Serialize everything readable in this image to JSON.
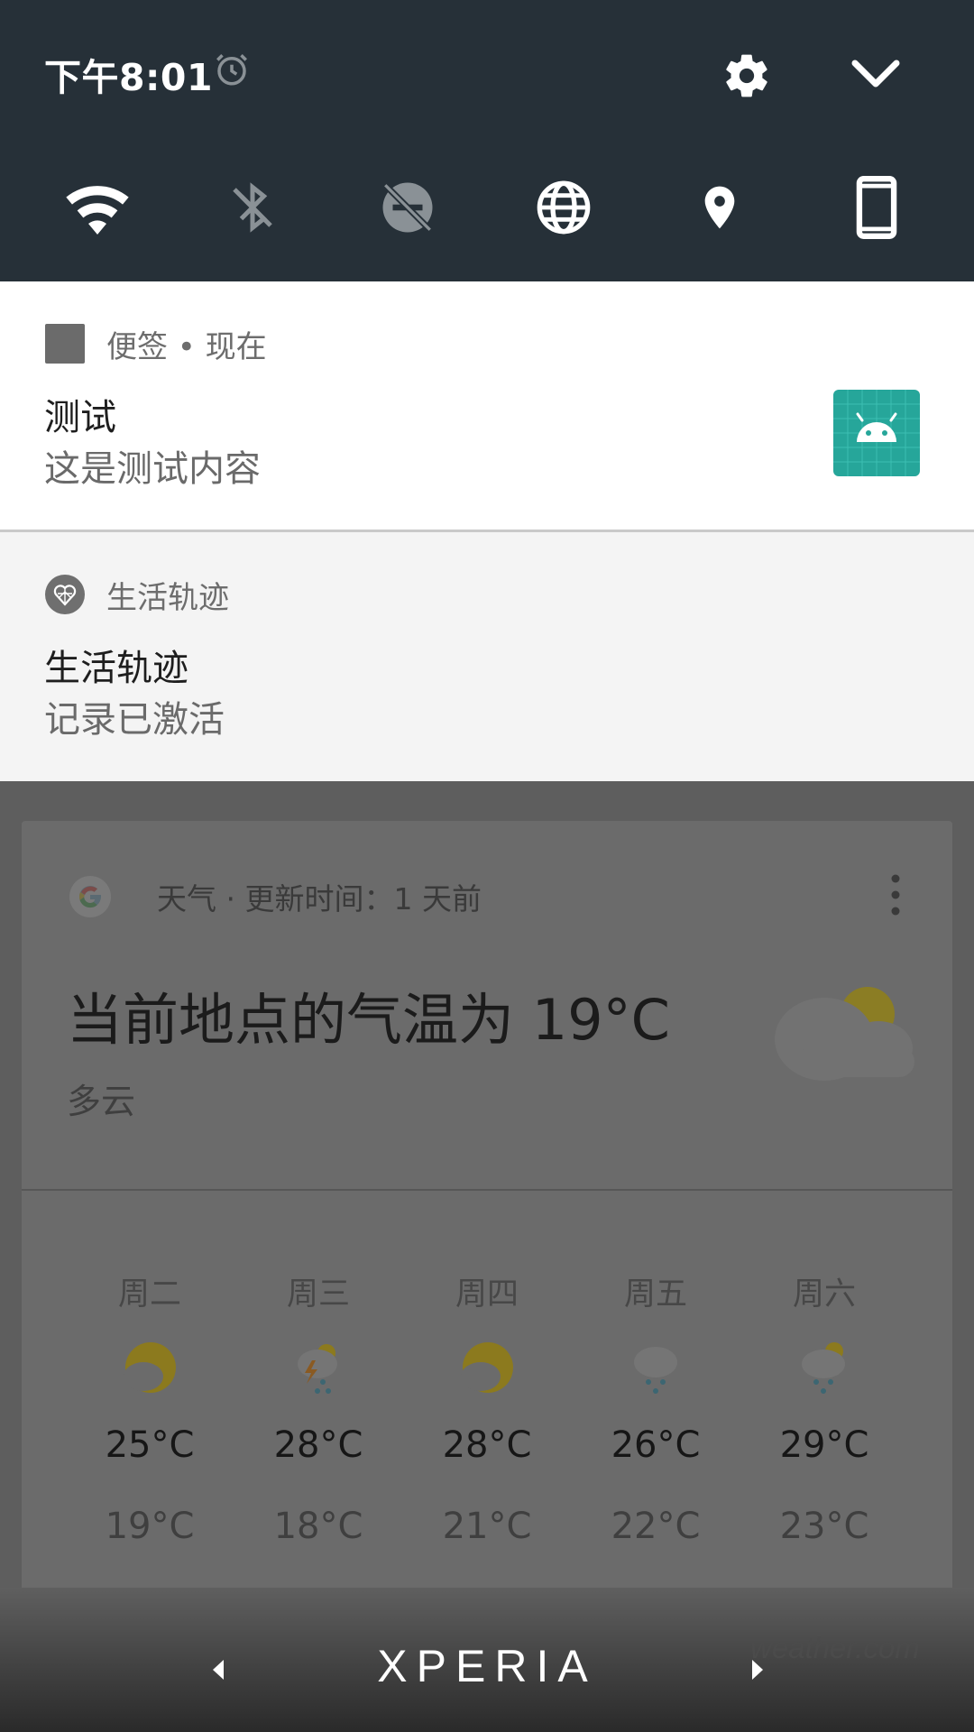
{
  "status": {
    "time": "下午8:01"
  },
  "quick_settings": {
    "tiles": [
      "wifi-icon",
      "bluetooth-off-icon",
      "do-not-disturb-off-icon",
      "globe-icon",
      "location-icon",
      "rotation-portrait-icon"
    ]
  },
  "notifications": [
    {
      "app": "便签 • 现在",
      "title": "测试",
      "text": "这是测试内容",
      "thumb_color": "#26a69a"
    },
    {
      "app": "生活轨迹",
      "title": "生活轨迹",
      "text": "记录已激活"
    }
  ],
  "weather_card": {
    "source": "天气 · 更新时间：1 天前",
    "current_temp": "当前地点的气温为 19°C",
    "condition": "多云",
    "forecast": [
      {
        "day": "周二",
        "icon": "partly-cloudy-icon",
        "high": "25°C",
        "low": "19°C"
      },
      {
        "day": "周三",
        "icon": "thunder-rain-icon",
        "high": "28°C",
        "low": "18°C"
      },
      {
        "day": "周四",
        "icon": "partly-cloudy-icon",
        "high": "28°C",
        "low": "21°C"
      },
      {
        "day": "周五",
        "icon": "rain-icon",
        "high": "26°C",
        "low": "22°C"
      },
      {
        "day": "周六",
        "icon": "sun-rain-icon",
        "high": "29°C",
        "low": "23°C"
      }
    ]
  },
  "bottom_bar": {
    "brand": "XPERIA",
    "weather_brand": "weather.com"
  }
}
